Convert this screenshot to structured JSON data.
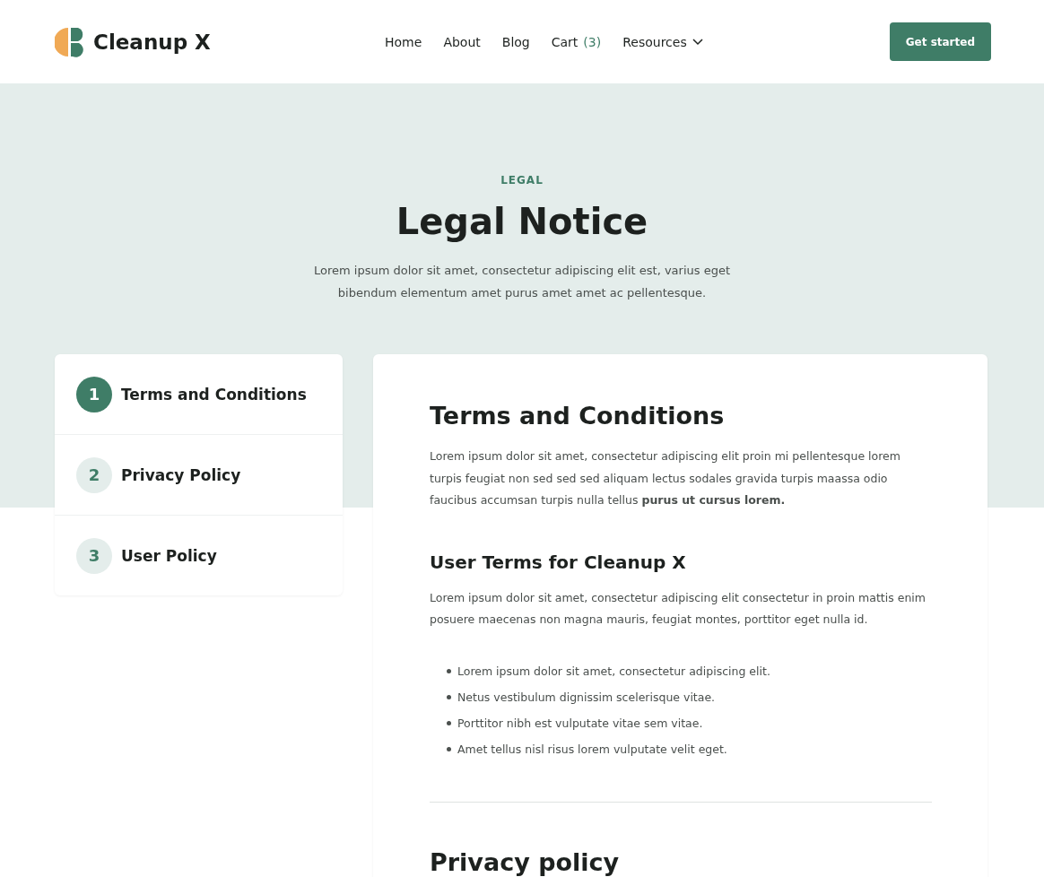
{
  "header": {
    "logo_text": "Cleanup X",
    "nav": [
      {
        "label": "Home",
        "kind": "link"
      },
      {
        "label": "About",
        "kind": "link"
      },
      {
        "label": "Blog",
        "kind": "link"
      },
      {
        "label": "Cart",
        "count": "(3)",
        "kind": "link"
      },
      {
        "label": "Resources",
        "kind": "dropdown"
      }
    ],
    "cta": "Get started"
  },
  "hero": {
    "eyebrow": "LEGAL",
    "title": "Legal Notice",
    "subtitle": "Lorem ipsum dolor sit amet, consectetur adipiscing elit est, varius eget bibendum elementum amet purus amet amet ac pellentesque."
  },
  "steps": [
    {
      "number": "1",
      "label": "Terms and Conditions",
      "selected": true
    },
    {
      "number": "2",
      "label": "Privacy Policy",
      "selected": false
    },
    {
      "number": "3",
      "label": "User Policy",
      "selected": false
    }
  ],
  "article": {
    "blocks": [
      {
        "kind": "h2",
        "text": "Terms and Conditions"
      },
      {
        "kind": "p",
        "text": "Lorem ipsum dolor sit amet, consectetur adipiscing elit proin mi pellentesque  lorem turpis feugiat non sed sed sed aliquam lectus sodales gravida turpis maassa odio faucibus accumsan turpis nulla tellus **purus ut cursus lorem.**"
      },
      {
        "kind": "h3",
        "text": "User Terms for Cleanup X"
      },
      {
        "kind": "p",
        "text": "Lorem ipsum dolor sit amet, consectetur adipiscing elit consectetur in proin mattis enim posuere maecenas non magna mauris, feugiat montes, porttitor eget nulla id."
      },
      {
        "kind": "list",
        "items": [
          "Lorem ipsum dolor sit amet, consectetur adipiscing elit.",
          "Netus vestibulum dignissim scelerisque vitae.",
          "Porttitor nibh est vulputate vitae sem vitae.",
          "Amet tellus nisl risus lorem vulputate velit eget."
        ]
      },
      {
        "kind": "divider"
      },
      {
        "kind": "h2",
        "text": "Privacy policy"
      }
    ]
  }
}
